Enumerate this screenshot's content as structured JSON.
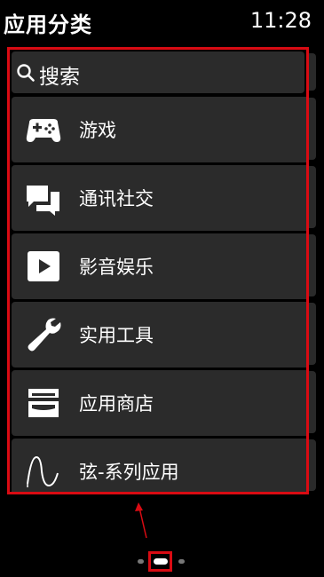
{
  "header": {
    "title": "应用分类",
    "time": "11:28"
  },
  "search": {
    "label": "搜索",
    "icon": "search-icon"
  },
  "categories": [
    {
      "label": "游戏",
      "icon": "gamepad-icon"
    },
    {
      "label": "通讯社交",
      "icon": "chat-bubbles-icon"
    },
    {
      "label": "影音娱乐",
      "icon": "play-icon"
    },
    {
      "label": "实用工具",
      "icon": "wrench-icon"
    },
    {
      "label": "应用商店",
      "icon": "store-icon"
    },
    {
      "label": "弦-系列应用",
      "icon": "waveform-icon"
    }
  ],
  "colors": {
    "highlight": "#d90b13",
    "row_bg": "#2b2b2b",
    "background": "#000000"
  }
}
